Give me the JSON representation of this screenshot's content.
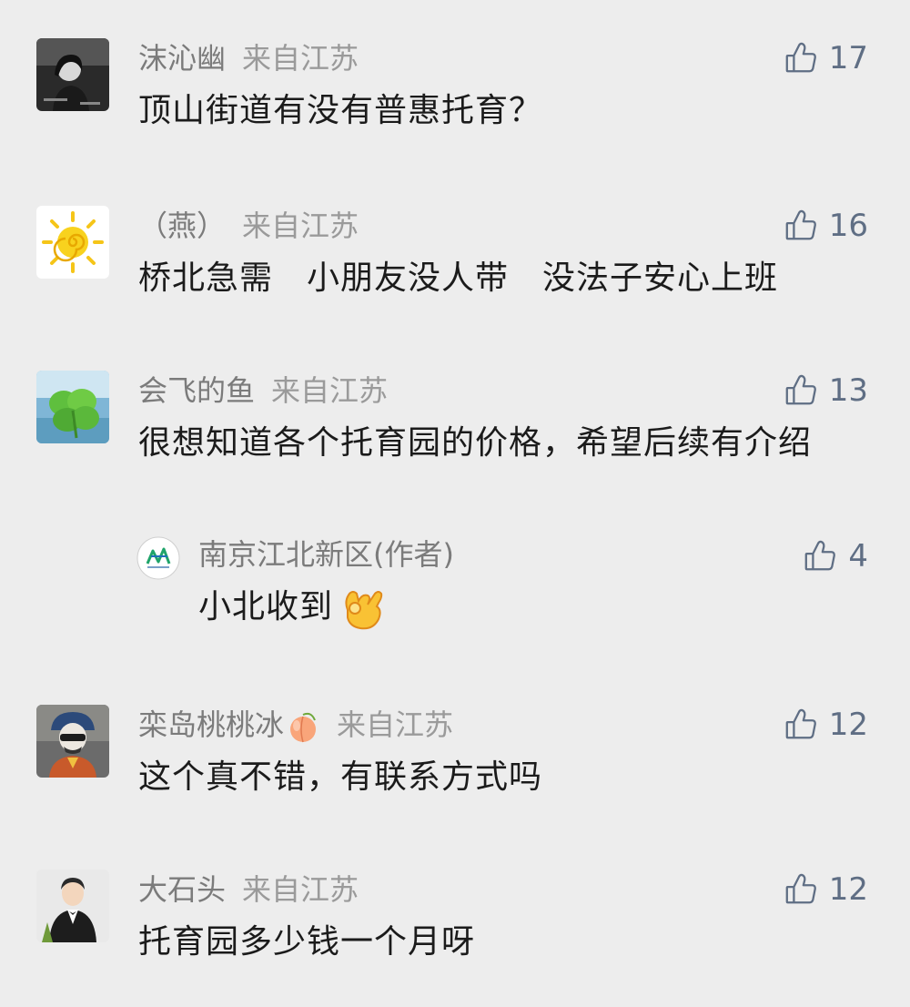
{
  "comments": [
    {
      "nickname": "沫沁幽",
      "origin": "来自江苏",
      "likes": "17",
      "text": "顶山街道有没有普惠托育？"
    },
    {
      "nickname": "（燕）",
      "origin": "来自江苏",
      "likes": "16",
      "text": "桥北急需　小朋友没人带　没法子安心上班"
    },
    {
      "nickname": "会飞的鱼",
      "origin": "来自江苏",
      "likes": "13",
      "text": "很想知道各个托育园的价格，希望后续有介绍",
      "reply": {
        "nickname": "南京江北新区(作者)",
        "likes": "4",
        "text": "小北收到",
        "emoji": "ok-hand"
      }
    },
    {
      "nickname": "栾岛桃桃冰",
      "nickname_emoji": "peach",
      "origin": "来自江苏",
      "likes": "12",
      "text": "这个真不错，有联系方式吗"
    },
    {
      "nickname": "大石头",
      "origin": "来自江苏",
      "likes": "12",
      "text": "托育园多少钱一个月呀"
    }
  ],
  "icons": {
    "like": "thumbs-up-icon",
    "ok": "ok-hand-emoji-icon",
    "peach": "peach-emoji-icon"
  },
  "colors": {
    "background": "#ededed",
    "like": "#5f6e84",
    "nickname": "#7b7b7b",
    "text": "#1b1b1b"
  }
}
